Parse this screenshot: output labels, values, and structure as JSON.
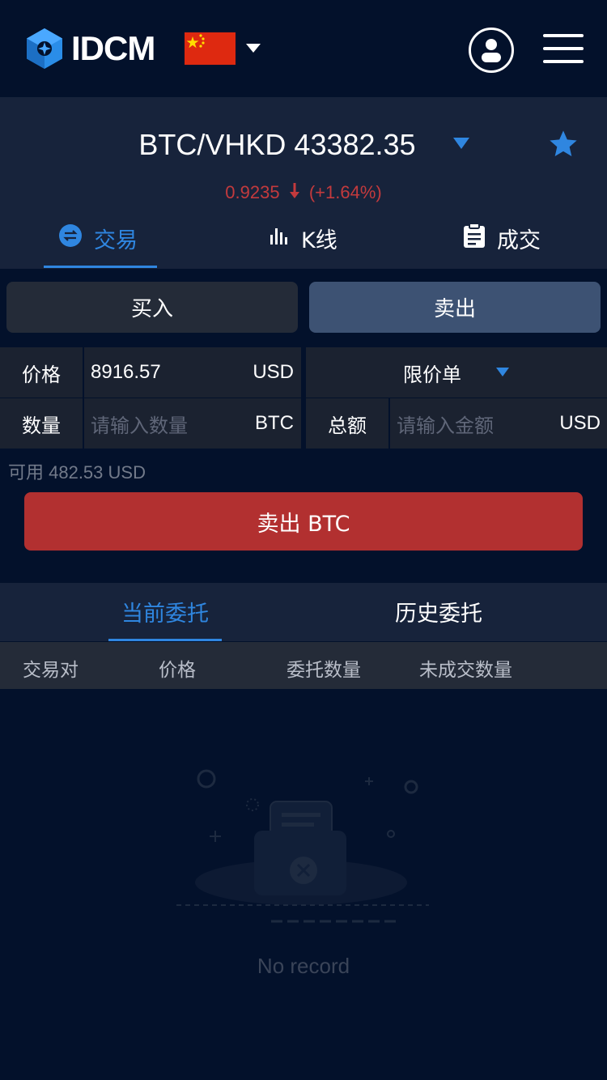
{
  "header": {
    "brand": "IDCM",
    "flag_icon": "china-flag",
    "user_icon": "user-icon",
    "menu_icon": "hamburger-menu-icon"
  },
  "pair": {
    "title": "BTC/VHKD 43382.35",
    "change_value": "0.9235",
    "change_pct": "(+1.64%)",
    "down_color": "#c33a3d"
  },
  "nav_tabs": [
    {
      "label": "交易",
      "icon": "exchange-icon",
      "active": true
    },
    {
      "label": "K线",
      "icon": "bar-chart-icon",
      "active": false
    },
    {
      "label": "成交",
      "icon": "clipboard-icon",
      "active": false
    }
  ],
  "side_toggle": {
    "buy": "买入",
    "sell": "卖出",
    "selected": "sell"
  },
  "form": {
    "price_label": "价格",
    "price_value": "8916.57",
    "price_unit": "USD",
    "order_type": "限价单",
    "qty_label": "数量",
    "qty_placeholder": "请输入数量",
    "qty_unit": "BTC",
    "total_label": "总额",
    "total_placeholder": "请输入金额",
    "total_unit": "USD"
  },
  "available": "可用 482.53 USD",
  "submit_label": "卖出 BTC",
  "orders": {
    "tabs": [
      "当前委托",
      "历史委托"
    ],
    "columns": [
      "交易对",
      "价格",
      "委托数量",
      "未成交数量"
    ],
    "empty_text": "No record"
  },
  "colors": {
    "accent": "#2f86e0",
    "sell": "#b23030",
    "background": "#03112b"
  }
}
